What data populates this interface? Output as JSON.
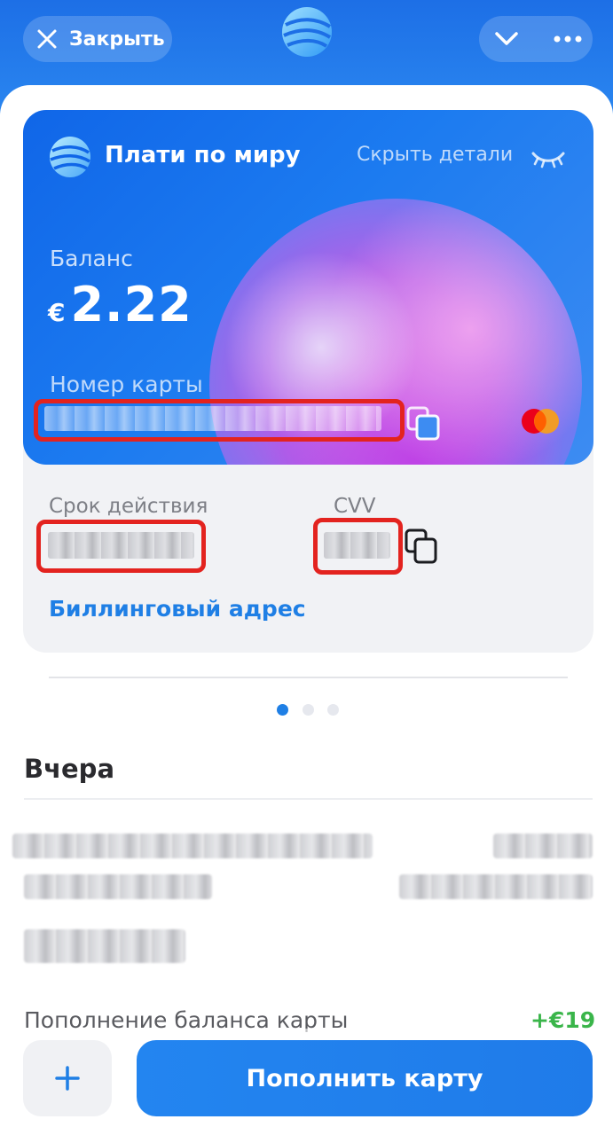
{
  "header": {
    "close_label": "Закрыть",
    "close_icon": "close-icon",
    "logo_icon": "globe-logo-icon",
    "collapse_icon": "chevron-down-icon",
    "menu_icon": "more-dots-icon",
    "background_color": "#1d6fe6"
  },
  "card": {
    "brand_name": "Плати по миру",
    "hide_details_label": "Скрыть детали",
    "balance_label": "Баланс",
    "currency_symbol": "€",
    "balance_value": "2.22",
    "card_number_label": "Номер карты",
    "network": "mastercard",
    "accent_color": "#1066e8"
  },
  "details": {
    "expiry_label": "Срок действия",
    "cvv_label": "CVV",
    "billing_address_label": "Биллинговый адрес",
    "link_color": "#1f7fe5"
  },
  "pager": {
    "total_pages": 3,
    "current_page": 1
  },
  "transactions": {
    "section_title": "Вчера",
    "visible_item": {
      "title": "Пополнение баланса карты",
      "amount": "+€19",
      "amount_color": "#3ab54a"
    }
  },
  "footer": {
    "add_icon": "plus-icon",
    "topup_label": "Пополнить карту",
    "button_color": "#2385f0"
  }
}
